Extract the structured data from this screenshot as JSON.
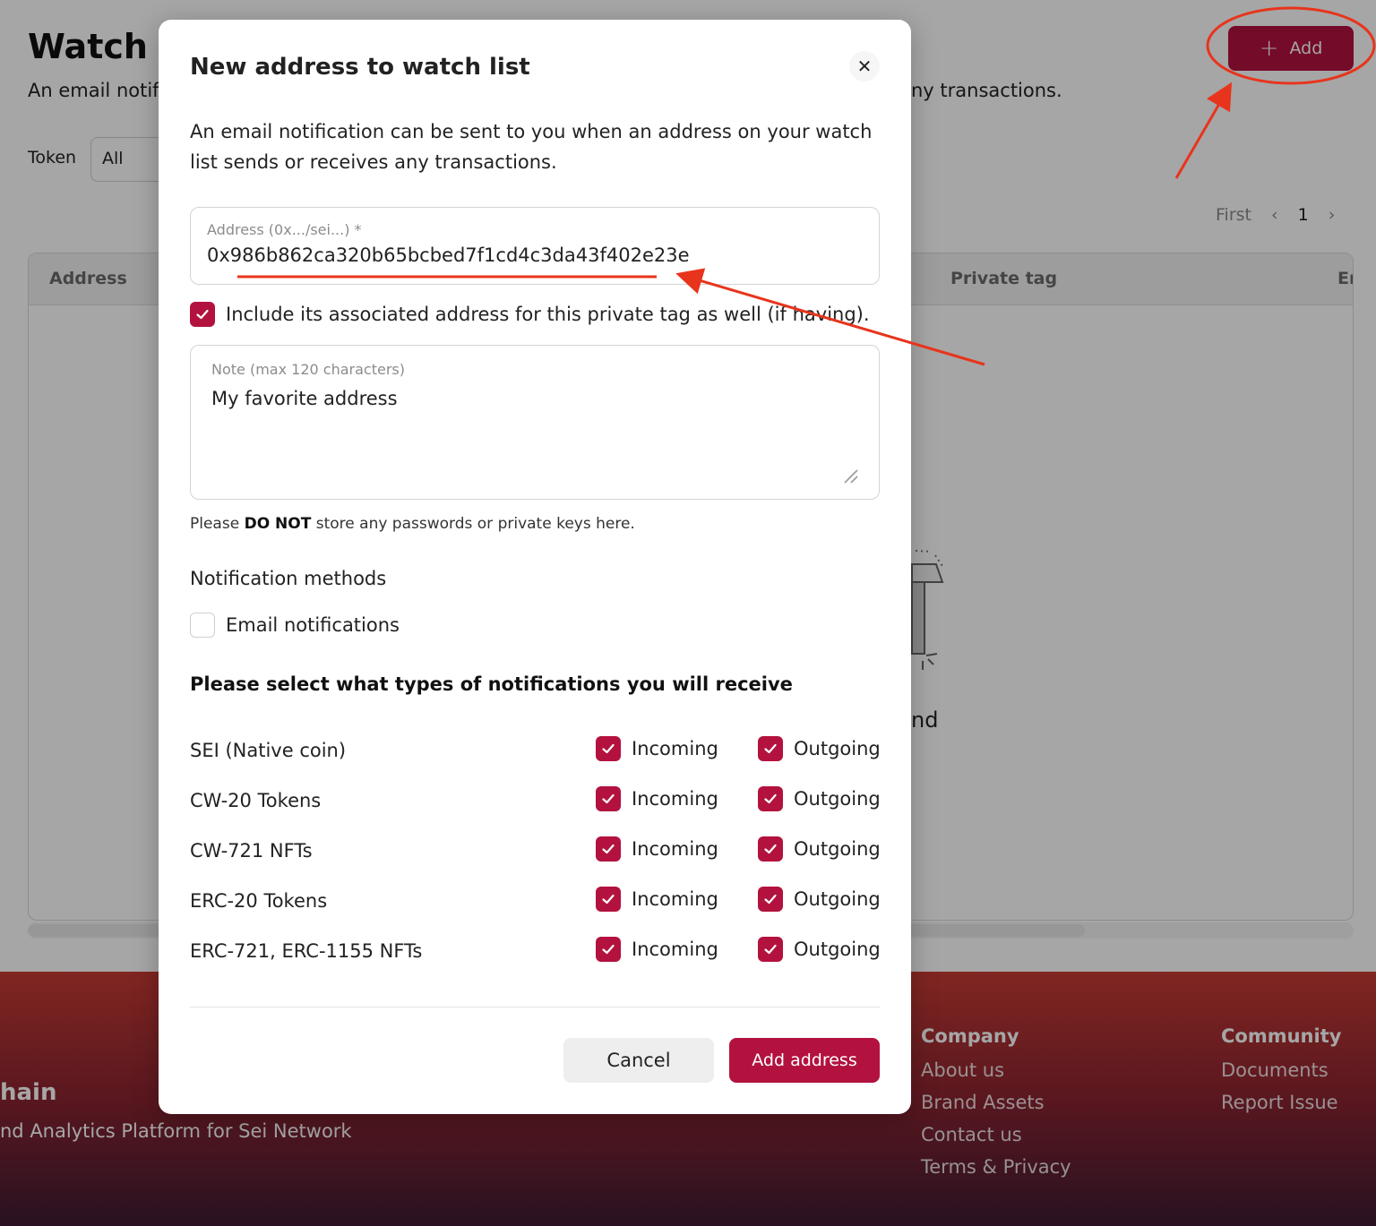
{
  "page": {
    "title": "Watch li",
    "subtitle": "An email notifi",
    "subtitle_tail": "ny transactions.",
    "add_button_label": "Add",
    "token_label": "Token",
    "token_value": "All",
    "pagination": {
      "first": "First",
      "prev_icon": "chevron-left-icon",
      "current": "1",
      "next_icon": "chevron-right-icon"
    },
    "table_headers": [
      "Address",
      "Private tag",
      "Er"
    ],
    "empty_text": "nd"
  },
  "footer": {
    "brand": "hain",
    "tagline": "nd Analytics Platform for Sei Network",
    "company": {
      "title": "Company",
      "links": [
        "About us",
        "Brand Assets",
        "Contact us",
        "Terms & Privacy"
      ]
    },
    "community": {
      "title": "Community",
      "links": [
        "Documents",
        "Report Issue"
      ]
    },
    "background_gradient": [
      "#c63b33",
      "#8a2431",
      "#3e1c33"
    ]
  },
  "modal": {
    "title": "New address to watch list",
    "close_icon": "close-icon",
    "description": "An email notification can be sent to you when an address on your watch list sends or receives any transactions.",
    "address_label": "Address (0x.../sei...) *",
    "address_value": "0x986b862ca320b65bcbed7f1cd4c3da43f402e23e",
    "include_associated": {
      "label": "Include its associated address for this private tag as well (if having).",
      "checked": true
    },
    "note_label": "Note (max 120 characters)",
    "note_value": "My favorite address",
    "warning_prefix": "Please ",
    "warning_bold": "DO NOT",
    "warning_suffix": " store any passwords or private keys here.",
    "methods_title": "Notification methods",
    "email_notifications": {
      "label": "Email notifications",
      "checked": false
    },
    "types_title": "Please select what types of notifications you will receive",
    "types": [
      {
        "name": "SEI (Native coin)",
        "incoming": "Incoming",
        "outgoing": "Outgoing",
        "incoming_checked": true,
        "outgoing_checked": true
      },
      {
        "name": "CW-20 Tokens",
        "incoming": "Incoming",
        "outgoing": "Outgoing",
        "incoming_checked": true,
        "outgoing_checked": true
      },
      {
        "name": "CW-721 NFTs",
        "incoming": "Incoming",
        "outgoing": "Outgoing",
        "incoming_checked": true,
        "outgoing_checked": true
      },
      {
        "name": "ERC-20 Tokens",
        "incoming": "Incoming",
        "outgoing": "Outgoing",
        "incoming_checked": true,
        "outgoing_checked": true
      },
      {
        "name": "ERC-721, ERC-1155 NFTs",
        "incoming": "Incoming",
        "outgoing": "Outgoing",
        "incoming_checked": true,
        "outgoing_checked": true
      }
    ],
    "cancel_label": "Cancel",
    "submit_label": "Add address"
  },
  "colors": {
    "accent": "#b3123e",
    "annotation": "#e8341c"
  }
}
